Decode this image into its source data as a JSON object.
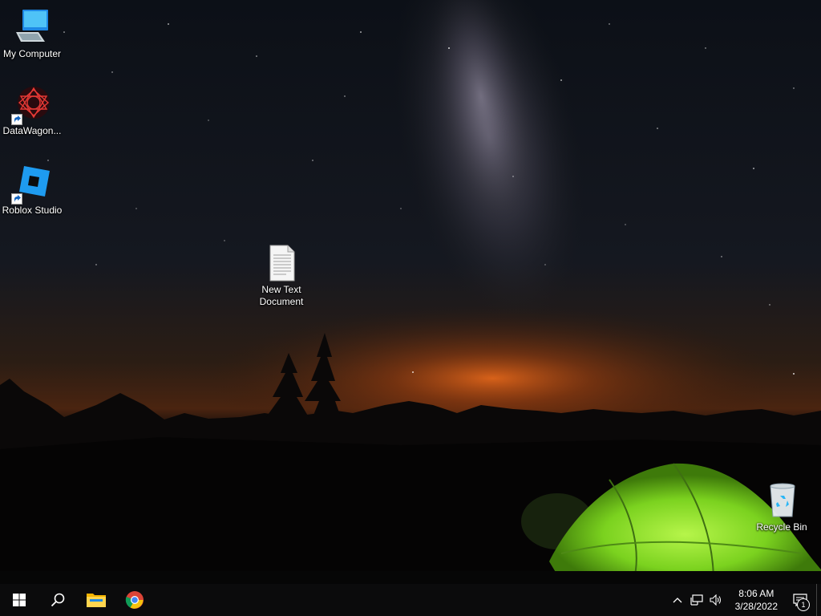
{
  "desktop": {
    "icons": [
      {
        "label": "My Computer",
        "icon": "computer-icon"
      },
      {
        "label": "DataWagon...",
        "icon": "datawagon-icon",
        "shortcut": true
      },
      {
        "label": "Roblox Studio",
        "icon": "roblox-studio-icon",
        "shortcut": true
      },
      {
        "label": "New Text Document",
        "icon": "text-document-icon"
      },
      {
        "label": "Recycle Bin",
        "icon": "recycle-bin-icon"
      }
    ]
  },
  "taskbar": {
    "start": {
      "icon": "windows-logo-icon"
    },
    "search": {
      "icon": "search-icon"
    },
    "pinned": [
      {
        "name": "File Explorer",
        "icon": "folder-icon"
      },
      {
        "name": "Google Chrome",
        "icon": "chrome-icon"
      }
    ],
    "tray": {
      "icons": [
        "chevron-up-icon",
        "network-icon",
        "volume-icon"
      ],
      "time": "8:06 AM",
      "date": "3/28/2022",
      "notifications": {
        "icon": "notification-icon",
        "count": "1"
      }
    }
  },
  "colors": {
    "taskbar": "#0b0b0c",
    "tent": "#8ee02a",
    "horizon_glow": "#e0651a"
  }
}
